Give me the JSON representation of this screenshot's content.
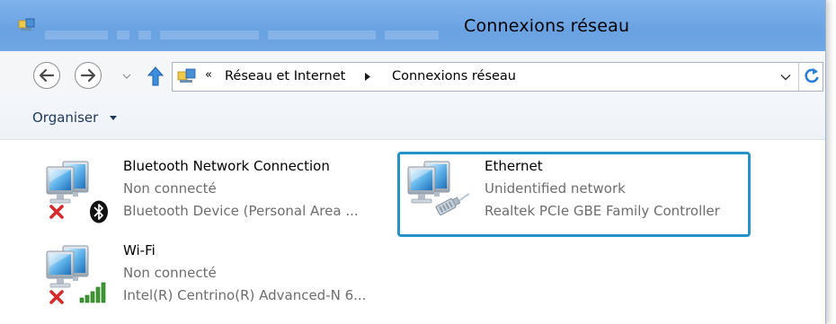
{
  "window": {
    "title": "Connexions réseau"
  },
  "address_bar": {
    "overflow_glyph": "«",
    "breadcrumb": [
      "Réseau et Internet",
      "Connexions réseau"
    ]
  },
  "command_bar": {
    "organize_label": "Organiser"
  },
  "connections": [
    {
      "name": "Bluetooth Network Connection",
      "status": "Non connecté",
      "device": "Bluetooth Device (Personal Area ...",
      "icon": "bluetooth-network-icon",
      "disconnected": true
    },
    {
      "name": "Ethernet",
      "status": "Unidentified network",
      "device": "Realtek PCIe GBE Family Controller",
      "icon": "ethernet-network-icon",
      "disconnected": false,
      "highlighted": true
    },
    {
      "name": "Wi-Fi",
      "status": "Non connecté",
      "device": "Intel(R) Centrino(R) Advanced-N 6...",
      "icon": "wifi-network-icon",
      "disconnected": true
    }
  ],
  "colors": {
    "titlebar": "#6fa6e4",
    "highlight_border": "#2693c8",
    "status_text": "#6d6d6d",
    "error_x": "#d62a2a",
    "wifi_bars": "#3c9a2e"
  }
}
